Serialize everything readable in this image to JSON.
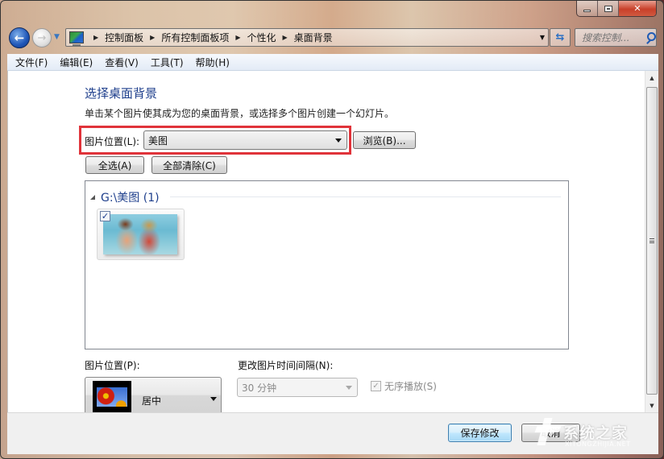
{
  "window": {
    "caption": {
      "minimize": "minimize",
      "maximize": "maximize",
      "close": "close"
    }
  },
  "nav": {
    "breadcrumbs": [
      "控制面板",
      "所有控制面板项",
      "个性化",
      "桌面背景"
    ],
    "search_placeholder": "搜索控制..."
  },
  "menu": {
    "items": [
      "文件(F)",
      "编辑(E)",
      "查看(V)",
      "工具(T)",
      "帮助(H)"
    ]
  },
  "main": {
    "title": "选择桌面背景",
    "description": "单击某个图片使其成为您的桌面背景，或选择多个图片创建一个幻灯片。",
    "location_label": "图片位置(L):",
    "location_value": "美图",
    "browse_label": "浏览(B)...",
    "select_all_label": "全选(A)",
    "clear_all_label": "全部清除(C)",
    "gallery": {
      "group_title": "G:\\美图 (1)",
      "items": [
        {
          "checked": true,
          "thumbnail": "anime-two-characters"
        }
      ]
    },
    "position_label": "图片位置(P):",
    "position_value": "居中",
    "interval_label": "更改图片时间间隔(N):",
    "interval_value": "30 分钟",
    "shuffle_label": "无序播放(S)",
    "shuffle_checked": true
  },
  "footer": {
    "save_label": "保存修改",
    "cancel_label": "取消"
  },
  "watermark": {
    "text": "系统之家",
    "subtext": "XITONGZHIJIA.NET"
  },
  "colors": {
    "title_blue": "#1e3f8c",
    "highlight_red": "#e0333a"
  }
}
